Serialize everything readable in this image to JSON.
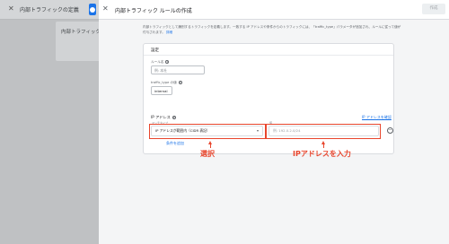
{
  "background": {
    "title": "内部トラフィックの定義",
    "card_text": "内部トラフィック"
  },
  "panel": {
    "title": "内部トラフィック ルールの作成",
    "save_label": "作成",
    "description": "内部トラフィックとして識別するトラフィックを定義します。一致する IP アドレスや条件からのトラフィックには、「traffic_type」パラメータが追加され、ルールに従って値が付与されます。",
    "description_link": "詳細"
  },
  "settings": {
    "header": "設定",
    "rule_name_label": "ルール名",
    "rule_name_placeholder": "例: 本社",
    "traffic_type_label": "traffic_type の値",
    "traffic_type_value": "internal",
    "ip_label": "IP アドレス",
    "ip_help_link": "IP アドレスを確認",
    "match_type_label": "マッチタイプ",
    "match_type_value": "IP アドレスが範囲内（CIDR 表記）",
    "ip_value_label": "値",
    "ip_value_placeholder": "例: 192.0.2.0/24",
    "add_condition": "条件を追加"
  },
  "annotations": {
    "select": "選択",
    "ip_input": "IPアドレスを入力",
    "color": "#e8452c"
  }
}
